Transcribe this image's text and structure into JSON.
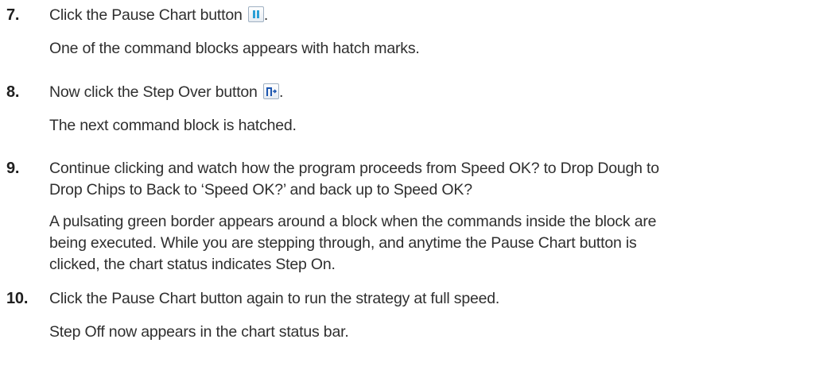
{
  "steps": [
    {
      "number": "7.",
      "instruction_before": "Click the Pause Chart button",
      "icon": "pause-chart-icon",
      "instruction_after": ".",
      "result": "One of the command blocks appears with hatch marks."
    },
    {
      "number": "8.",
      "instruction_before": "Now click the Step Over button",
      "icon": "step-over-icon",
      "instruction_after": ".",
      "result": "The next command block is hatched."
    },
    {
      "number": "9.",
      "instruction_line1": "Continue clicking and watch how the program proceeds from Speed OK? to Drop Dough to",
      "instruction_line2": "Drop Chips to Back to ‘Speed OK?’ and back up to Speed OK?",
      "result_line1": "A pulsating green border appears around a block when the commands inside the block are",
      "result_line2": "being executed. While you are stepping through, and anytime the Pause Chart button is",
      "result_line3": "clicked, the chart status indicates Step On."
    },
    {
      "number": "10.",
      "instruction": "Click the Pause Chart button again to run the strategy at full speed.",
      "result": "Step Off now appears in the chart status bar."
    }
  ],
  "colors": {
    "text": "#2f2f2f",
    "pause_icon": "#2a9fd6",
    "step_over_icon": "#1c56b0"
  }
}
